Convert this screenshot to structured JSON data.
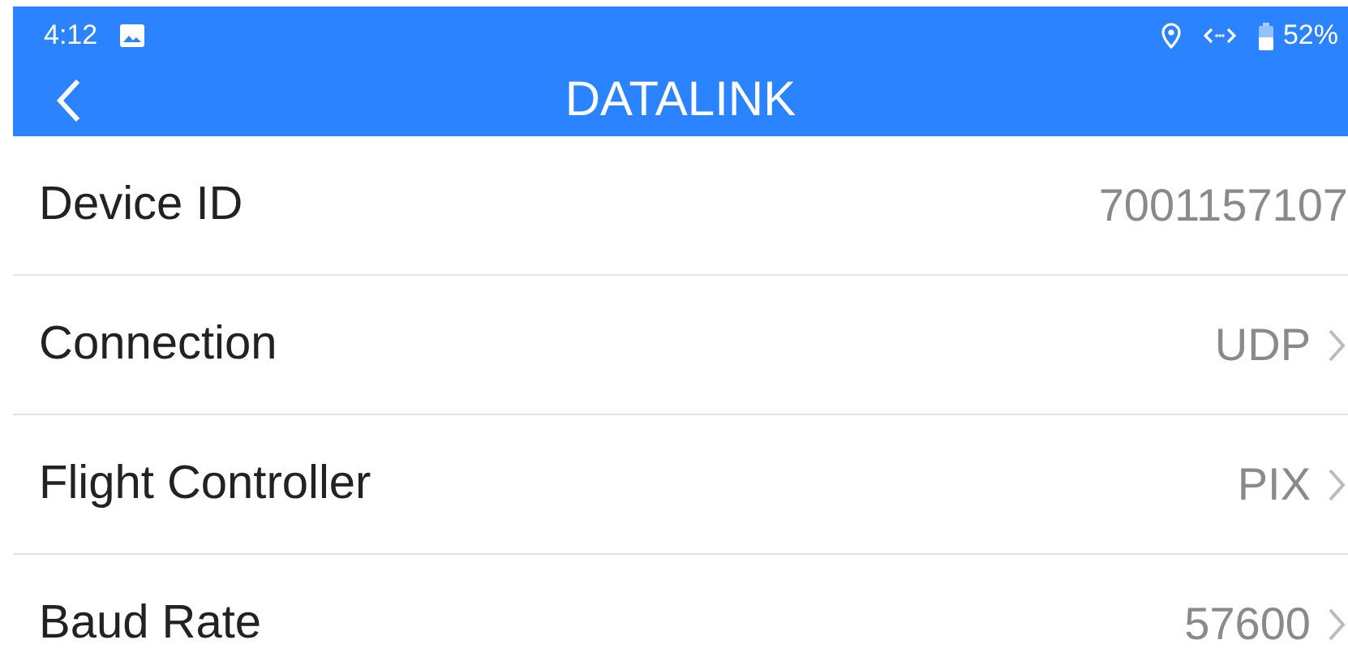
{
  "status_bar": {
    "time": "4:12",
    "battery": "52%"
  },
  "title_bar": {
    "title": "DATALINK"
  },
  "rows": [
    {
      "label": "Device ID",
      "value": "7001157107",
      "kind": "value"
    },
    {
      "label": "Connection",
      "value": "UDP",
      "kind": "link"
    },
    {
      "label": "Flight Controller",
      "value": "PIX",
      "kind": "link"
    },
    {
      "label": "Baud Rate",
      "value": "57600",
      "kind": "link"
    }
  ]
}
